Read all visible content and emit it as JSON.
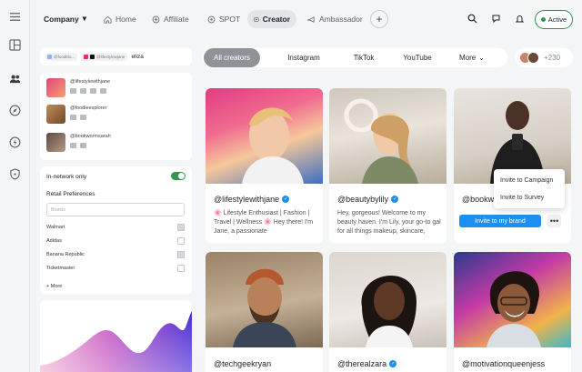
{
  "nav": {
    "company": "Company",
    "tabs": [
      {
        "label": "Home",
        "icon": "home-icon"
      },
      {
        "label": "Affiliate",
        "icon": "affiliate-icon"
      },
      {
        "label": "SPOT",
        "icon": "spot-icon"
      },
      {
        "label": "Creator",
        "icon": "creator-icon",
        "active": true
      },
      {
        "label": "Ambassador",
        "icon": "ambassador-icon"
      }
    ],
    "plus": "+",
    "status": "Active"
  },
  "search": {
    "chips": [
      "@foodblo...",
      "@lifestylewjane"
    ],
    "query": "eliza"
  },
  "mini_creators": [
    {
      "handle": "@lifestylewithjane"
    },
    {
      "handle": "@foodieexplorer"
    },
    {
      "handle": "@bookwormsarah"
    }
  ],
  "filters": {
    "in_network_label": "In-network only",
    "in_network_on": true,
    "retail_title": "Retail Preferences",
    "brands_placeholder": "Brands",
    "brands": [
      {
        "name": "Walmart",
        "checked": true
      },
      {
        "name": "Adidas",
        "checked": false
      },
      {
        "name": "Banana Republic",
        "checked": true
      },
      {
        "name": "Ticketmaster",
        "checked": false
      }
    ],
    "more": "+ More"
  },
  "platform_tabs": [
    "All creators",
    "Instagram",
    "TikTok",
    "YouTube",
    "More"
  ],
  "creator_count": "+230",
  "cards": [
    {
      "handle": "@lifestylewithjane",
      "bio": "🌸 Lifestyle Enthusiast | Fashion | Travel | Wellness 🌸 Hey there! I'm Jane, a passionate"
    },
    {
      "handle": "@beautybylily",
      "bio": "Hey, gorgeous! Welcome to my beauty haven. I'm Lily, your go-to gal for all things makeup, skincare,"
    },
    {
      "handle": "@bookwo",
      "bio": ""
    },
    {
      "handle": "@techgeekryan",
      "bio": ""
    },
    {
      "handle": "@therealzara",
      "bio": ""
    },
    {
      "handle": "@motivationqueenjess",
      "bio": ""
    }
  ],
  "invite_button": "Invite to my brand",
  "dropdown": [
    "Invite to Campaign",
    "Invite to Survey"
  ],
  "colors": {
    "accent": "#1d8ff0",
    "active_green": "#2f9a4f"
  }
}
